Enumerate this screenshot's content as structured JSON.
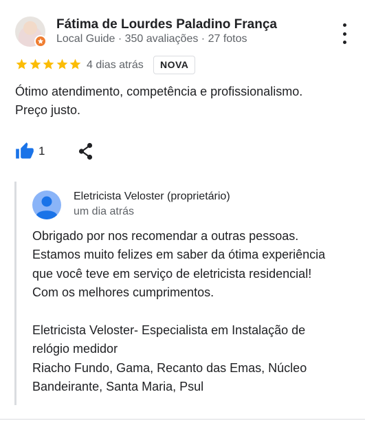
{
  "review": {
    "author": {
      "name": "Fátima de Lourdes Paladino França",
      "meta": "Local Guide · 350 avaliações · 27 fotos"
    },
    "rating": {
      "value": 5,
      "max": 5,
      "color": "#fbbc04"
    },
    "date": "4 dias atrás",
    "badge": "NOVA",
    "text_lines": [
      "Ótimo atendimento, competência e profissionalismo.",
      "Preço justo."
    ],
    "likes": "1",
    "icons": {
      "more": "more-vert-icon",
      "like": "thumb-up-icon",
      "share": "share-icon",
      "badge": "local-guide-badge-icon"
    }
  },
  "reply": {
    "owner_name": "Eletricista Veloster (proprietário)",
    "date": "um dia atrás",
    "text_lines": [
      "Obrigado por nos recomendar a outras pessoas.",
      "Estamos muito felizes em saber da ótima experiência",
      "que você teve em serviço de eletricista residencial!",
      "Com os melhores cumprimentos.",
      "",
      "Eletricista Veloster- Especialista em Instalação de",
      "relógio medidor",
      "Riacho Fundo, Gama, Recanto das Emas, Núcleo",
      "Bandeirante, Santa Maria, Psul"
    ]
  },
  "colors": {
    "like_blue": "#1a73e8",
    "guide_orange": "#ef7c2f",
    "avatar_blue": "#8ab4f8"
  }
}
